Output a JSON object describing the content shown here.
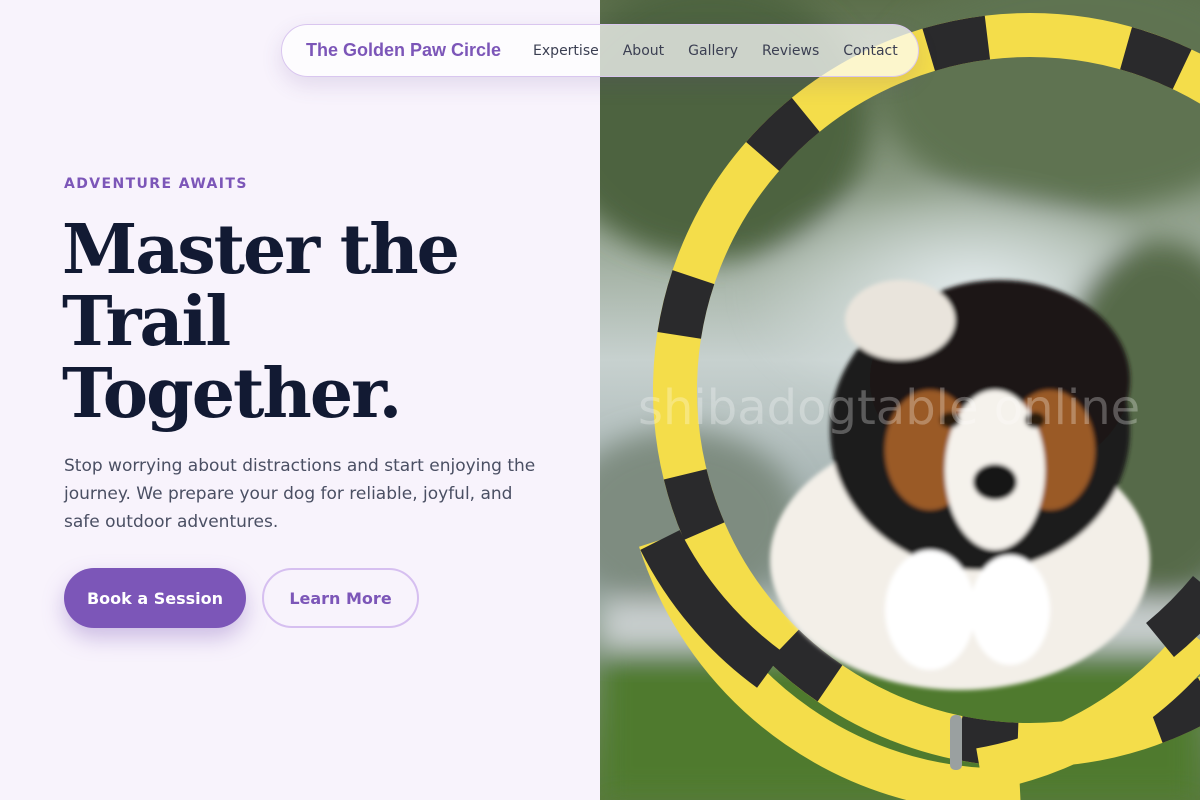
{
  "nav": {
    "brand": "The Golden Paw Circle",
    "links": [
      "Expertise",
      "About",
      "Gallery",
      "Reviews",
      "Contact"
    ]
  },
  "hero": {
    "eyebrow": "ADVENTURE AWAITS",
    "headline": [
      "Master the",
      "Trail",
      "Together."
    ],
    "description": "Stop worrying about distractions and start enjoying the journey. We prepare your dog for reliable, joyful, and safe outdoor adventures.",
    "primary_cta": "Book a Session",
    "secondary_cta": "Learn More"
  },
  "photo": {
    "watermark": "shibadogtable online"
  },
  "colors": {
    "accent": "#7c56b8",
    "background": "#f8f3fc",
    "heading": "#121a33",
    "body_text": "#4a4f63",
    "hoop_yellow": "#f4dd4a",
    "hoop_black": "#2a2a2c"
  },
  "icons": []
}
